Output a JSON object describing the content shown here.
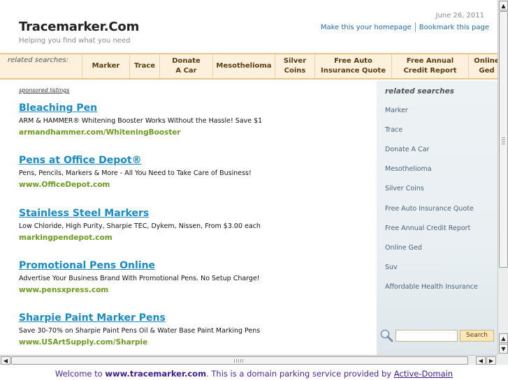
{
  "header": {
    "title": "Tracemarker.Com",
    "tagline": "Helping you find what you need",
    "date": "June 26, 2011",
    "homepage_link": "Make this your homepage",
    "bookmark_link": "Bookmark this page"
  },
  "related_bar": {
    "label": "related searches:",
    "items": [
      {
        "line1": "Marker",
        "line2": ""
      },
      {
        "line1": "Trace",
        "line2": ""
      },
      {
        "line1": "Donate",
        "line2": "A Car"
      },
      {
        "line1": "Mesothelioma",
        "line2": ""
      },
      {
        "line1": "Silver",
        "line2": "Coins"
      },
      {
        "line1": "Free Auto",
        "line2": "Insurance Quote"
      },
      {
        "line1": "Free Annual",
        "line2": "Credit Report"
      },
      {
        "line1": "Online",
        "line2": "Ged"
      }
    ]
  },
  "main": {
    "sponsored_label": "sponsored listings",
    "listings": [
      {
        "title": "Bleaching Pen",
        "description": "ARM & HAMMER® Whitening Booster Works Without the Hassle! Save $1",
        "url": "armandhammer.com/WhiteningBooster"
      },
      {
        "title": "Pens at Office Depot®",
        "description": "Pens, Pencils, Markers & More - All You Need to Take Care of Business!",
        "url": "www.OfficeDepot.com"
      },
      {
        "title": "Stainless Steel Markers",
        "description": "Low Chloride, High Purity, Sharpie TEC, Dykem, Nissen, From $3.00 each",
        "url": "markingpendepot.com"
      },
      {
        "title": "Promotional Pens Online",
        "description": "Advertise Your Business Brand With Promotional Pens. No Setup Charge!",
        "url": "www.pensxpress.com"
      },
      {
        "title": "Sharpie Paint Marker Pens",
        "description": "Save 30-70% on Sharpie Paint Pens Oil & Water Base Paint Marking Pens",
        "url": "www.USArtSupply.com/Sharpie"
      }
    ]
  },
  "sidebar": {
    "title": "related searches",
    "items": [
      "Marker",
      "Trace",
      "Donate A Car",
      "Mesothelioma",
      "Silver Coins",
      "Free Auto Insurance Quote",
      "Free Annual Credit Report",
      "Online Ged",
      "Suv",
      "Affordable Health Insurance"
    ],
    "search_button": "Search",
    "search_value": ""
  },
  "footer": {
    "prefix": "Welcome to ",
    "domain": "www.tracemarker.com",
    "middle": ". This is a domain parking service provided by ",
    "provider": "Active-Domain"
  },
  "icons": {
    "search": "magnifier-icon",
    "scroll_up": "arrow-up-icon",
    "scroll_down": "arrow-down-icon",
    "scroll_left": "arrow-left-icon",
    "scroll_right": "arrow-right-icon"
  },
  "colors": {
    "link_blue": "#1a8bc4",
    "url_green": "#6b9b1f",
    "bar_bg": "#fdf1de",
    "footer_purple": "#3c1b95"
  }
}
